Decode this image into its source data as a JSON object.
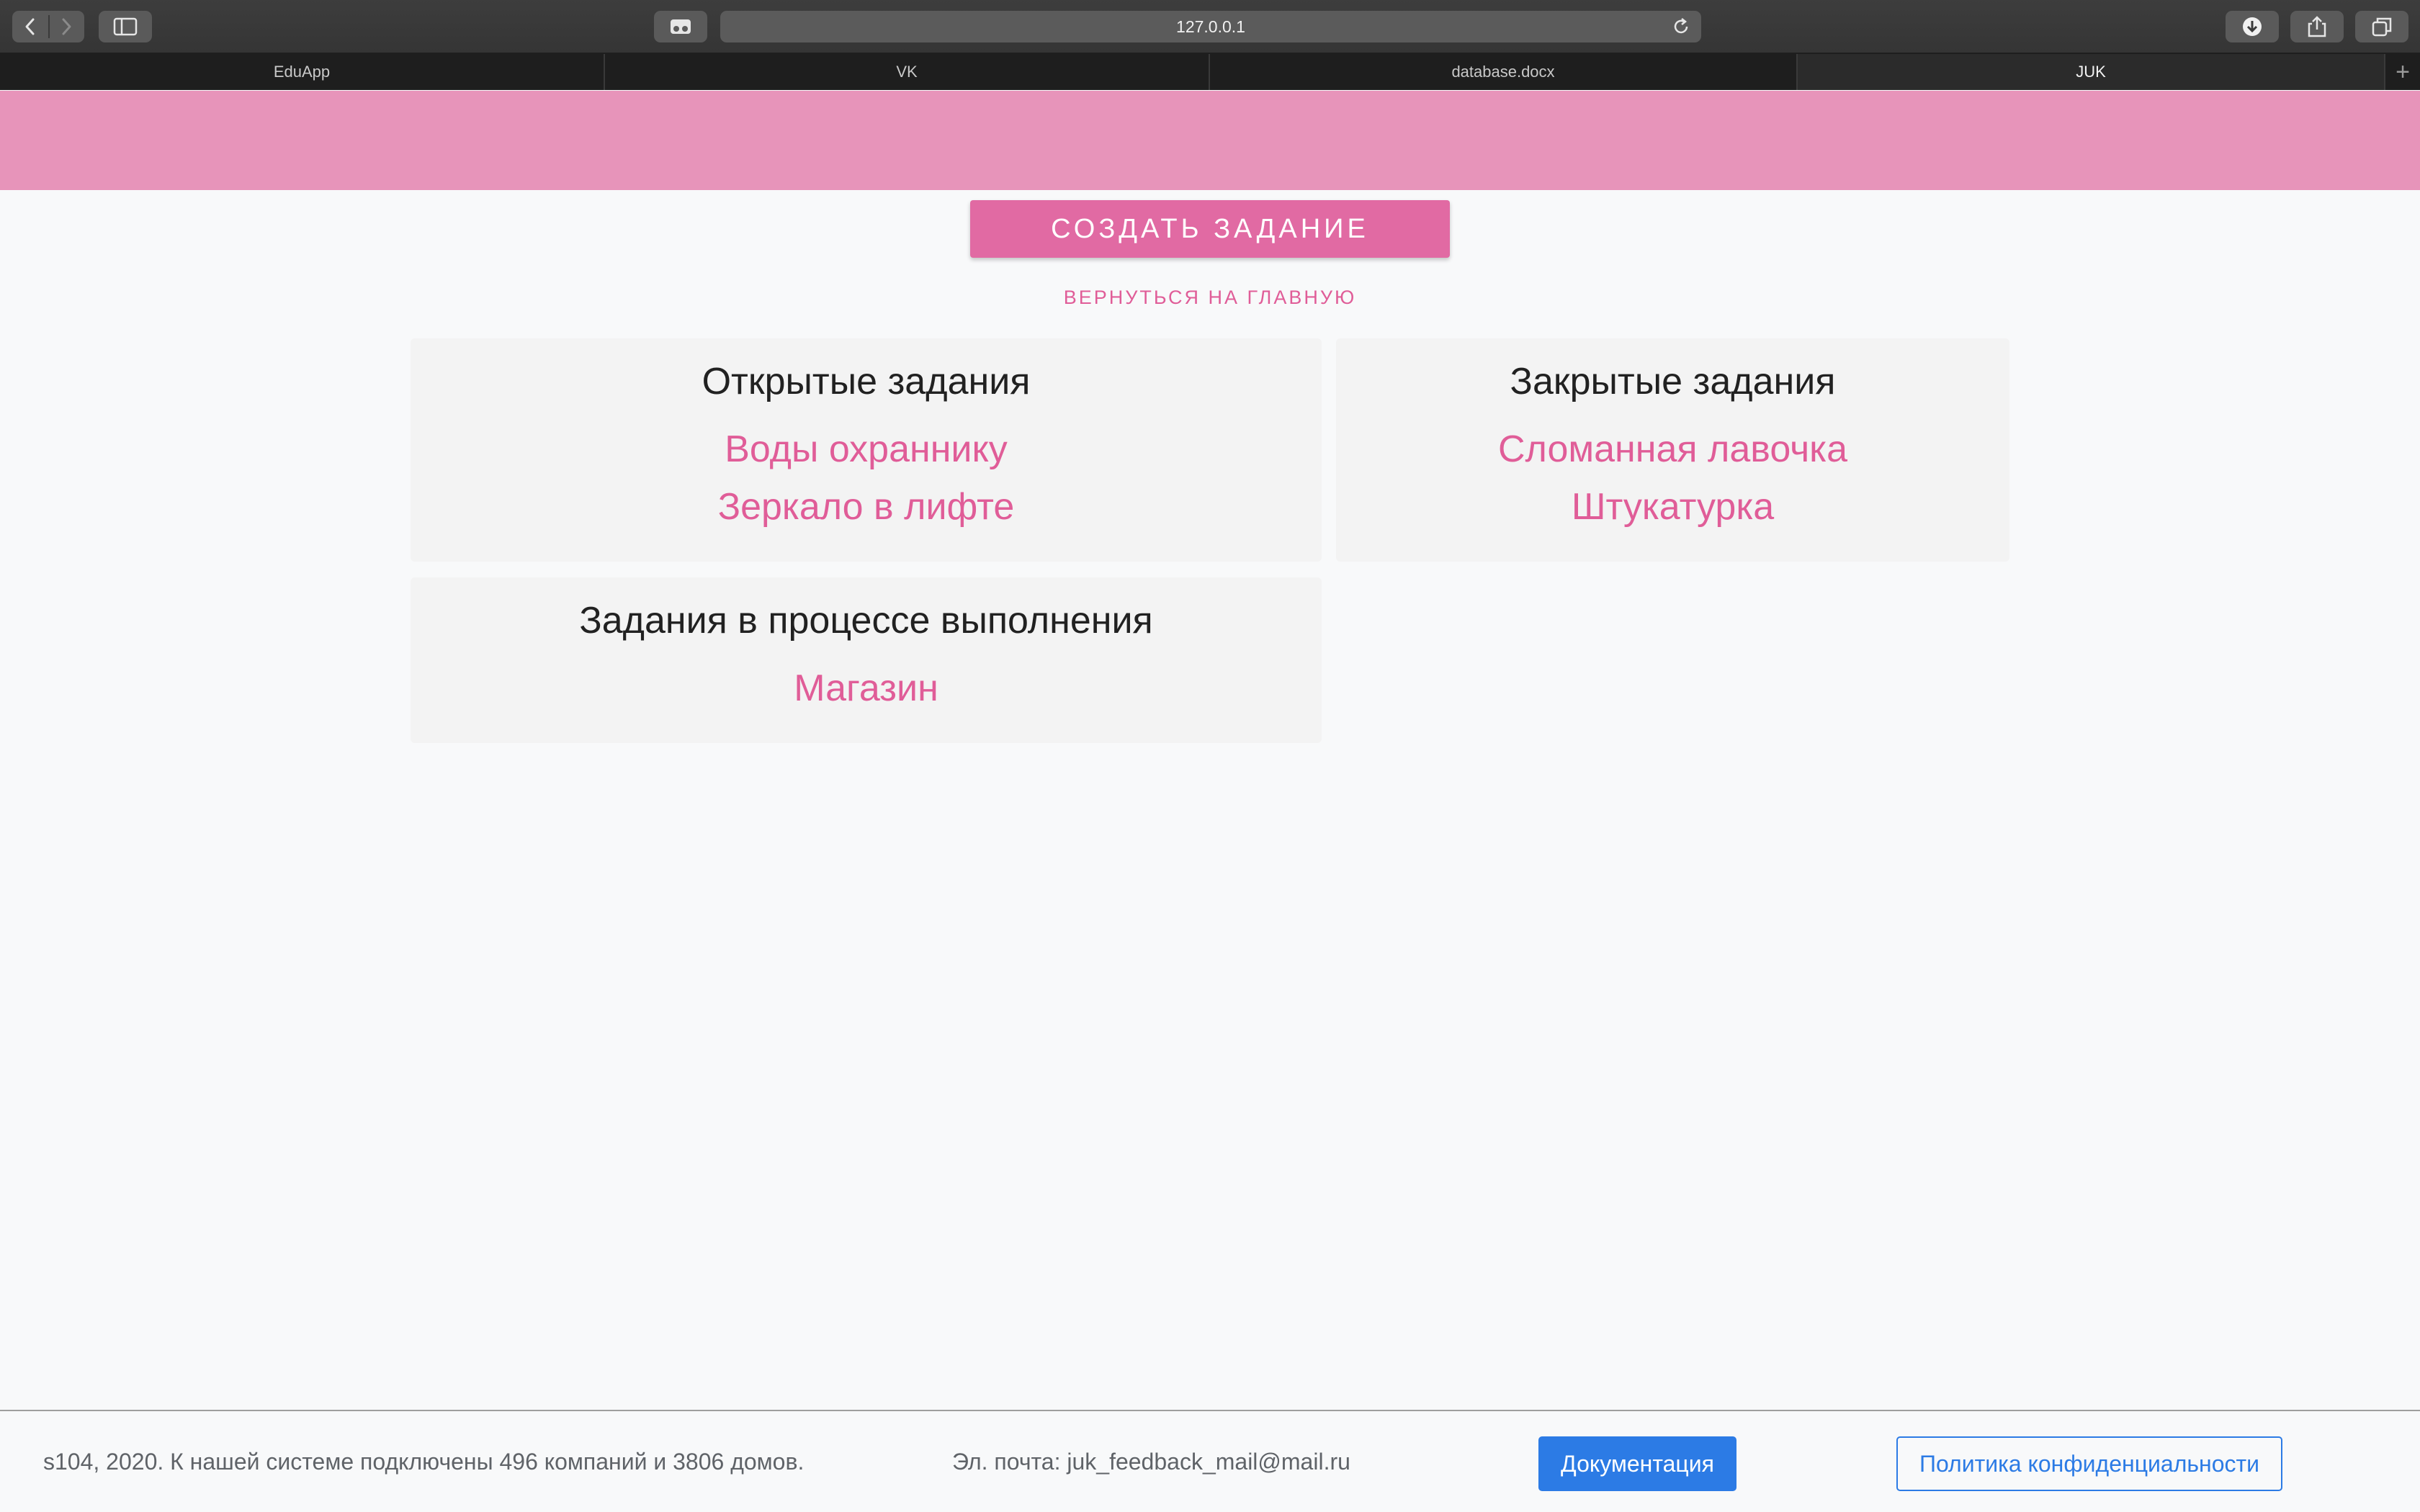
{
  "browser": {
    "url": "127.0.0.1",
    "tabs": [
      {
        "label": "EduApp",
        "active": false
      },
      {
        "label": "VK",
        "active": false
      },
      {
        "label": "database.docx",
        "active": false
      },
      {
        "label": "JUK",
        "active": true
      }
    ],
    "icons": [
      "back-icon",
      "forward-icon",
      "sidebar-icon",
      "reader-icon",
      "reload-icon",
      "download-icon",
      "share-icon",
      "tabs-icon",
      "new-tab-icon"
    ]
  },
  "page": {
    "create_button": "СОЗДАТЬ ЗАДАНИЕ",
    "back_link": "ВЕРНУТЬСЯ НА ГЛАВНУЮ",
    "sections": {
      "open": {
        "title": "Открытые задания",
        "items": [
          "Воды охраннику",
          "Зеркало в лифте"
        ]
      },
      "closed": {
        "title": "Закрытые задания",
        "items": [
          "Сломанная лавочка",
          "Штукатурка"
        ]
      },
      "in_progress": {
        "title": "Задания в процессе выполнения",
        "items": [
          "Магазин"
        ]
      }
    }
  },
  "footer": {
    "copyright": "s104, 2020. К нашей системе подключены 496 компаний и 3806 домов.",
    "email": "Эл. почта: juk_feedback_mail@mail.ru",
    "docs_button": "Документация",
    "policy_button": "Политика конфиденциальности"
  },
  "colors": {
    "header": "#e794ba",
    "accent": "#e16aa3",
    "link": "#e05d98",
    "primary": "#2c7be5"
  }
}
